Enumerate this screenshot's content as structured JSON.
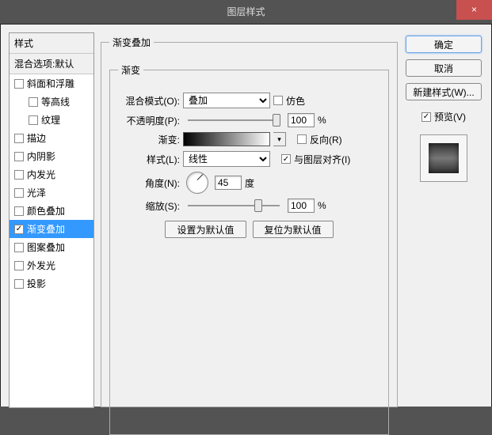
{
  "window": {
    "title": "图层样式",
    "close": "×"
  },
  "left": {
    "heading": "样式",
    "sub": "混合选项:默认",
    "items": [
      {
        "label": "斜面和浮雕",
        "checked": false,
        "indent": false,
        "sel": false
      },
      {
        "label": "等高线",
        "checked": false,
        "indent": true,
        "sel": false
      },
      {
        "label": "纹理",
        "checked": false,
        "indent": true,
        "sel": false
      },
      {
        "label": "描边",
        "checked": false,
        "indent": false,
        "sel": false
      },
      {
        "label": "内阴影",
        "checked": false,
        "indent": false,
        "sel": false
      },
      {
        "label": "内发光",
        "checked": false,
        "indent": false,
        "sel": false
      },
      {
        "label": "光泽",
        "checked": false,
        "indent": false,
        "sel": false
      },
      {
        "label": "颜色叠加",
        "checked": false,
        "indent": false,
        "sel": false
      },
      {
        "label": "渐变叠加",
        "checked": true,
        "indent": false,
        "sel": true
      },
      {
        "label": "图案叠加",
        "checked": false,
        "indent": false,
        "sel": false
      },
      {
        "label": "外发光",
        "checked": false,
        "indent": false,
        "sel": false
      },
      {
        "label": "投影",
        "checked": false,
        "indent": false,
        "sel": false
      }
    ]
  },
  "center": {
    "legend": "渐变叠加",
    "inner_legend": "渐变",
    "blend_label": "混合模式(O):",
    "blend_value": "叠加",
    "dither": "仿色",
    "opacity_label": "不透明度(P):",
    "opacity_value": "100",
    "percent": "%",
    "gradient_label": "渐变:",
    "reverse": "反向(R)",
    "style_label": "样式(L):",
    "style_value": "线性",
    "align": "与图层对齐(I)",
    "angle_label": "角度(N):",
    "angle_value": "45",
    "degree": "度",
    "scale_label": "缩放(S):",
    "scale_value": "100",
    "btn_default": "设置为默认值",
    "btn_reset": "复位为默认值"
  },
  "right": {
    "ok": "确定",
    "cancel": "取消",
    "new_style": "新建样式(W)...",
    "preview": "预览(V)"
  }
}
